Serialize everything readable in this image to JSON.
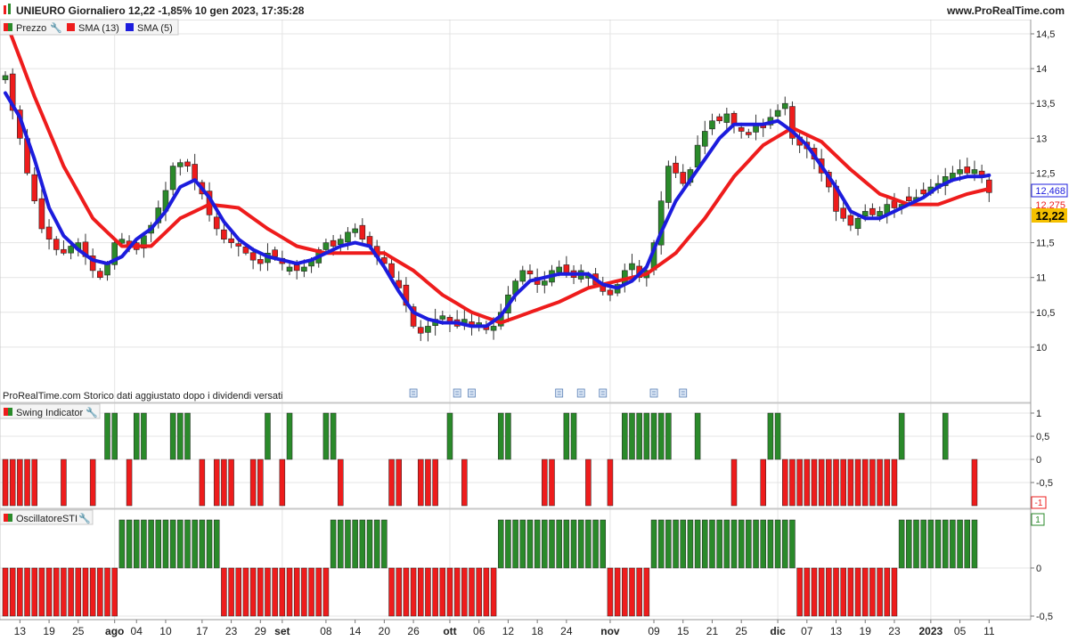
{
  "header": {
    "title": "UNIEURO Giornaliero 12,22 -1,85% 10 gen 2023, 17:35:28",
    "site": "www.ProRealTime.com"
  },
  "legend": [
    {
      "label": "Prezzo",
      "color": "#2a8a2a"
    },
    {
      "label": "SMA (13)",
      "color": "#ee1c1c"
    },
    {
      "label": "SMA (5)",
      "color": "#1c1cdd"
    }
  ],
  "notice": "ProRealTime.com  Storico dati aggiustato dopo i dividendi versati",
  "price_axis": {
    "ticks": [
      "14,5",
      "14",
      "13,5",
      "13",
      "12,5",
      "12",
      "11,5",
      "11",
      "10,5",
      "10"
    ],
    "tick_values": [
      14.5,
      14,
      13.5,
      13,
      12.5,
      12,
      11.5,
      11,
      10.5,
      10
    ],
    "badge_blue": "12,468",
    "badge_red": "12,275",
    "badge_last": "12,22"
  },
  "swing_panel": {
    "label": "Swing Indicator",
    "ticks": [
      "1",
      "0,5",
      "0",
      "-0,5"
    ],
    "tick_values": [
      1,
      0.5,
      0,
      -0.5
    ],
    "badge": "-1"
  },
  "sti_panel": {
    "label": "OscillatoreSTI",
    "ticks": [
      "0",
      "-0,5"
    ],
    "tick_values": [
      0,
      -0.5
    ],
    "badge": "1"
  },
  "x_axis": {
    "labels": [
      {
        "t": "13",
        "i": 2,
        "b": false
      },
      {
        "t": "19",
        "i": 6,
        "b": false
      },
      {
        "t": "25",
        "i": 10,
        "b": false
      },
      {
        "t": "ago",
        "i": 15,
        "b": true
      },
      {
        "t": "04",
        "i": 18,
        "b": false
      },
      {
        "t": "10",
        "i": 22,
        "b": false
      },
      {
        "t": "17",
        "i": 27,
        "b": false
      },
      {
        "t": "23",
        "i": 31,
        "b": false
      },
      {
        "t": "29",
        "i": 35,
        "b": false
      },
      {
        "t": "set",
        "i": 38,
        "b": true
      },
      {
        "t": "08",
        "i": 44,
        "b": false
      },
      {
        "t": "14",
        "i": 48,
        "b": false
      },
      {
        "t": "20",
        "i": 52,
        "b": false
      },
      {
        "t": "26",
        "i": 56,
        "b": false
      },
      {
        "t": "ott",
        "i": 61,
        "b": true
      },
      {
        "t": "06",
        "i": 65,
        "b": false
      },
      {
        "t": "12",
        "i": 69,
        "b": false
      },
      {
        "t": "18",
        "i": 73,
        "b": false
      },
      {
        "t": "24",
        "i": 77,
        "b": false
      },
      {
        "t": "nov",
        "i": 83,
        "b": true
      },
      {
        "t": "09",
        "i": 89,
        "b": false
      },
      {
        "t": "15",
        "i": 93,
        "b": false
      },
      {
        "t": "21",
        "i": 97,
        "b": false
      },
      {
        "t": "25",
        "i": 101,
        "b": false
      },
      {
        "t": "dic",
        "i": 106,
        "b": true
      },
      {
        "t": "07",
        "i": 110,
        "b": false
      },
      {
        "t": "13",
        "i": 114,
        "b": false
      },
      {
        "t": "19",
        "i": 118,
        "b": false
      },
      {
        "t": "23",
        "i": 122,
        "b": false
      },
      {
        "t": "2023",
        "i": 127,
        "b": true
      },
      {
        "t": "05",
        "i": 131,
        "b": false
      },
      {
        "t": "11",
        "i": 135,
        "b": false
      }
    ]
  },
  "colors": {
    "up": "#2a8a2a",
    "down": "#ee1c1c",
    "sma13": "#ee1c1c",
    "sma5": "#1c1cdd",
    "grid": "#e4e4e4",
    "wick": "#333333"
  },
  "chart_data": {
    "type": "candlestick",
    "title": "UNIEURO Giornaliero",
    "n_bars": 136,
    "price_keys": [
      [
        0,
        13.9
      ],
      [
        1,
        13.4
      ],
      [
        2,
        13.0
      ],
      [
        3,
        12.5
      ],
      [
        4,
        12.1
      ],
      [
        5,
        11.7
      ],
      [
        6,
        11.55
      ],
      [
        7,
        11.4
      ],
      [
        8,
        11.35
      ],
      [
        9,
        11.45
      ],
      [
        10,
        11.5
      ],
      [
        11,
        11.3
      ],
      [
        12,
        11.1
      ],
      [
        13,
        11.0
      ],
      [
        14,
        11.2
      ],
      [
        15,
        11.5
      ],
      [
        16,
        11.55
      ],
      [
        17,
        11.45
      ],
      [
        18,
        11.4
      ],
      [
        19,
        11.6
      ],
      [
        20,
        11.75
      ],
      [
        21,
        12.0
      ],
      [
        22,
        12.25
      ],
      [
        23,
        12.6
      ],
      [
        24,
        12.65
      ],
      [
        25,
        12.6
      ],
      [
        26,
        12.4
      ],
      [
        27,
        12.2
      ],
      [
        28,
        11.9
      ],
      [
        29,
        11.7
      ],
      [
        30,
        11.55
      ],
      [
        31,
        11.5
      ],
      [
        32,
        11.45
      ],
      [
        33,
        11.35
      ],
      [
        34,
        11.25
      ],
      [
        35,
        11.2
      ],
      [
        36,
        11.35
      ],
      [
        37,
        11.3
      ],
      [
        38,
        11.2
      ],
      [
        39,
        11.15
      ],
      [
        40,
        11.1
      ],
      [
        41,
        11.15
      ],
      [
        42,
        11.25
      ],
      [
        43,
        11.4
      ],
      [
        44,
        11.5
      ],
      [
        45,
        11.45
      ],
      [
        46,
        11.55
      ],
      [
        47,
        11.65
      ],
      [
        48,
        11.7
      ],
      [
        49,
        11.55
      ],
      [
        50,
        11.45
      ],
      [
        51,
        11.3
      ],
      [
        52,
        11.2
      ],
      [
        53,
        11.0
      ],
      [
        54,
        10.85
      ],
      [
        55,
        10.6
      ],
      [
        56,
        10.3
      ],
      [
        57,
        10.2
      ],
      [
        58,
        10.3
      ],
      [
        59,
        10.4
      ],
      [
        60,
        10.45
      ],
      [
        61,
        10.35
      ],
      [
        62,
        10.3
      ],
      [
        63,
        10.4
      ],
      [
        64,
        10.3
      ],
      [
        65,
        10.35
      ],
      [
        66,
        10.25
      ],
      [
        67,
        10.3
      ],
      [
        68,
        10.5
      ],
      [
        69,
        10.75
      ],
      [
        70,
        10.95
      ],
      [
        71,
        11.1
      ],
      [
        72,
        11.05
      ],
      [
        73,
        10.9
      ],
      [
        74,
        10.95
      ],
      [
        75,
        11.1
      ],
      [
        76,
        11.15
      ],
      [
        77,
        11.05
      ],
      [
        78,
        11.0
      ],
      [
        79,
        11.1
      ],
      [
        80,
        11.05
      ],
      [
        81,
        10.9
      ],
      [
        82,
        10.8
      ],
      [
        83,
        10.75
      ],
      [
        84,
        10.9
      ],
      [
        85,
        11.1
      ],
      [
        86,
        11.2
      ],
      [
        87,
        11.0
      ],
      [
        88,
        11.1
      ],
      [
        89,
        11.5
      ],
      [
        90,
        12.1
      ],
      [
        91,
        12.6
      ],
      [
        92,
        12.5
      ],
      [
        93,
        12.35
      ],
      [
        94,
        12.55
      ],
      [
        95,
        12.9
      ],
      [
        96,
        13.1
      ],
      [
        97,
        13.25
      ],
      [
        98,
        13.25
      ],
      [
        99,
        13.35
      ],
      [
        100,
        13.2
      ],
      [
        101,
        13.1
      ],
      [
        102,
        13.05
      ],
      [
        103,
        13.2
      ],
      [
        104,
        13.15
      ],
      [
        105,
        13.3
      ],
      [
        106,
        13.4
      ],
      [
        107,
        13.5
      ],
      [
        108,
        13.0
      ],
      [
        109,
        12.9
      ],
      [
        110,
        12.85
      ],
      [
        111,
        12.7
      ],
      [
        112,
        12.5
      ],
      [
        113,
        12.3
      ],
      [
        114,
        11.95
      ],
      [
        115,
        11.85
      ],
      [
        116,
        11.75
      ],
      [
        117,
        11.85
      ],
      [
        118,
        11.95
      ],
      [
        119,
        11.9
      ],
      [
        120,
        11.95
      ],
      [
        121,
        12.05
      ],
      [
        122,
        12.0
      ],
      [
        123,
        12.05
      ],
      [
        124,
        12.1
      ],
      [
        125,
        12.15
      ],
      [
        126,
        12.2
      ],
      [
        127,
        12.3
      ],
      [
        128,
        12.35
      ],
      [
        129,
        12.45
      ],
      [
        130,
        12.5
      ],
      [
        131,
        12.55
      ],
      [
        132,
        12.5
      ],
      [
        133,
        12.55
      ],
      [
        134,
        12.45
      ],
      [
        135,
        12.22
      ]
    ],
    "sma13_keys": [
      [
        0,
        14.7
      ],
      [
        4,
        13.6
      ],
      [
        8,
        12.6
      ],
      [
        12,
        11.85
      ],
      [
        16,
        11.45
      ],
      [
        20,
        11.45
      ],
      [
        24,
        11.85
      ],
      [
        28,
        12.05
      ],
      [
        32,
        12.0
      ],
      [
        36,
        11.7
      ],
      [
        40,
        11.45
      ],
      [
        44,
        11.35
      ],
      [
        48,
        11.35
      ],
      [
        52,
        11.35
      ],
      [
        56,
        11.1
      ],
      [
        60,
        10.75
      ],
      [
        64,
        10.5
      ],
      [
        68,
        10.35
      ],
      [
        72,
        10.5
      ],
      [
        76,
        10.65
      ],
      [
        80,
        10.85
      ],
      [
        84,
        10.95
      ],
      [
        88,
        11.05
      ],
      [
        92,
        11.35
      ],
      [
        96,
        11.85
      ],
      [
        100,
        12.45
      ],
      [
        104,
        12.9
      ],
      [
        108,
        13.15
      ],
      [
        112,
        12.95
      ],
      [
        116,
        12.55
      ],
      [
        120,
        12.2
      ],
      [
        124,
        12.05
      ],
      [
        128,
        12.05
      ],
      [
        132,
        12.2
      ],
      [
        135,
        12.275
      ]
    ],
    "sma5_keys": [
      [
        0,
        13.65
      ],
      [
        2,
        13.3
      ],
      [
        4,
        12.7
      ],
      [
        6,
        12.0
      ],
      [
        8,
        11.6
      ],
      [
        10,
        11.4
      ],
      [
        12,
        11.25
      ],
      [
        14,
        11.2
      ],
      [
        16,
        11.3
      ],
      [
        18,
        11.55
      ],
      [
        20,
        11.7
      ],
      [
        22,
        11.95
      ],
      [
        24,
        12.3
      ],
      [
        26,
        12.4
      ],
      [
        28,
        12.15
      ],
      [
        30,
        11.8
      ],
      [
        32,
        11.55
      ],
      [
        34,
        11.4
      ],
      [
        36,
        11.3
      ],
      [
        38,
        11.25
      ],
      [
        40,
        11.2
      ],
      [
        42,
        11.25
      ],
      [
        44,
        11.35
      ],
      [
        46,
        11.45
      ],
      [
        48,
        11.5
      ],
      [
        50,
        11.45
      ],
      [
        52,
        11.15
      ],
      [
        54,
        10.8
      ],
      [
        56,
        10.5
      ],
      [
        58,
        10.4
      ],
      [
        60,
        10.35
      ],
      [
        62,
        10.35
      ],
      [
        64,
        10.3
      ],
      [
        66,
        10.3
      ],
      [
        68,
        10.45
      ],
      [
        70,
        10.75
      ],
      [
        72,
        10.95
      ],
      [
        74,
        11.0
      ],
      [
        76,
        11.05
      ],
      [
        78,
        11.05
      ],
      [
        80,
        11.05
      ],
      [
        82,
        10.9
      ],
      [
        84,
        10.85
      ],
      [
        86,
        10.95
      ],
      [
        88,
        11.15
      ],
      [
        90,
        11.65
      ],
      [
        92,
        12.1
      ],
      [
        94,
        12.4
      ],
      [
        96,
        12.7
      ],
      [
        98,
        13.0
      ],
      [
        100,
        13.2
      ],
      [
        102,
        13.2
      ],
      [
        104,
        13.2
      ],
      [
        106,
        13.25
      ],
      [
        108,
        13.1
      ],
      [
        110,
        12.9
      ],
      [
        112,
        12.6
      ],
      [
        114,
        12.3
      ],
      [
        116,
        11.95
      ],
      [
        118,
        11.85
      ],
      [
        120,
        11.85
      ],
      [
        122,
        11.95
      ],
      [
        124,
        12.05
      ],
      [
        126,
        12.15
      ],
      [
        128,
        12.3
      ],
      [
        130,
        12.4
      ],
      [
        132,
        12.45
      ],
      [
        134,
        12.45
      ],
      [
        135,
        12.468
      ]
    ],
    "swing_runs": [
      [
        0,
        4,
        -1
      ],
      [
        8,
        8,
        -1
      ],
      [
        12,
        12,
        -1
      ],
      [
        14,
        15,
        1
      ],
      [
        17,
        17,
        -1
      ],
      [
        18,
        19,
        1
      ],
      [
        23,
        25,
        1
      ],
      [
        27,
        27,
        -1
      ],
      [
        29,
        31,
        -1
      ],
      [
        34,
        35,
        -1
      ],
      [
        36,
        36,
        1
      ],
      [
        38,
        38,
        -1
      ],
      [
        39,
        39,
        1
      ],
      [
        44,
        45,
        1
      ],
      [
        46,
        46,
        -1
      ],
      [
        53,
        54,
        -1
      ],
      [
        57,
        59,
        -1
      ],
      [
        61,
        61,
        1
      ],
      [
        63,
        63,
        -1
      ],
      [
        68,
        68,
        1
      ],
      [
        69,
        69,
        1
      ],
      [
        74,
        75,
        -1
      ],
      [
        77,
        78,
        1
      ],
      [
        80,
        80,
        -1
      ],
      [
        83,
        83,
        -1
      ],
      [
        85,
        87,
        1
      ],
      [
        88,
        88,
        1
      ],
      [
        89,
        91,
        1
      ],
      [
        95,
        95,
        1
      ],
      [
        100,
        100,
        -1
      ],
      [
        104,
        104,
        -1
      ],
      [
        105,
        106,
        1
      ],
      [
        107,
        113,
        -1
      ],
      [
        114,
        118,
        -1
      ],
      [
        119,
        119,
        -1
      ],
      [
        120,
        121,
        -1
      ],
      [
        122,
        122,
        -1
      ],
      [
        123,
        123,
        1
      ],
      [
        129,
        129,
        1
      ],
      [
        133,
        133,
        -1
      ]
    ],
    "sti_runs": [
      [
        0,
        15,
        -1
      ],
      [
        16,
        29,
        1
      ],
      [
        30,
        44,
        -1
      ],
      [
        45,
        52,
        1
      ],
      [
        53,
        67,
        -1
      ],
      [
        68,
        82,
        1
      ],
      [
        83,
        88,
        -1
      ],
      [
        89,
        108,
        1
      ],
      [
        109,
        122,
        -1
      ],
      [
        123,
        133,
        1
      ]
    ]
  }
}
